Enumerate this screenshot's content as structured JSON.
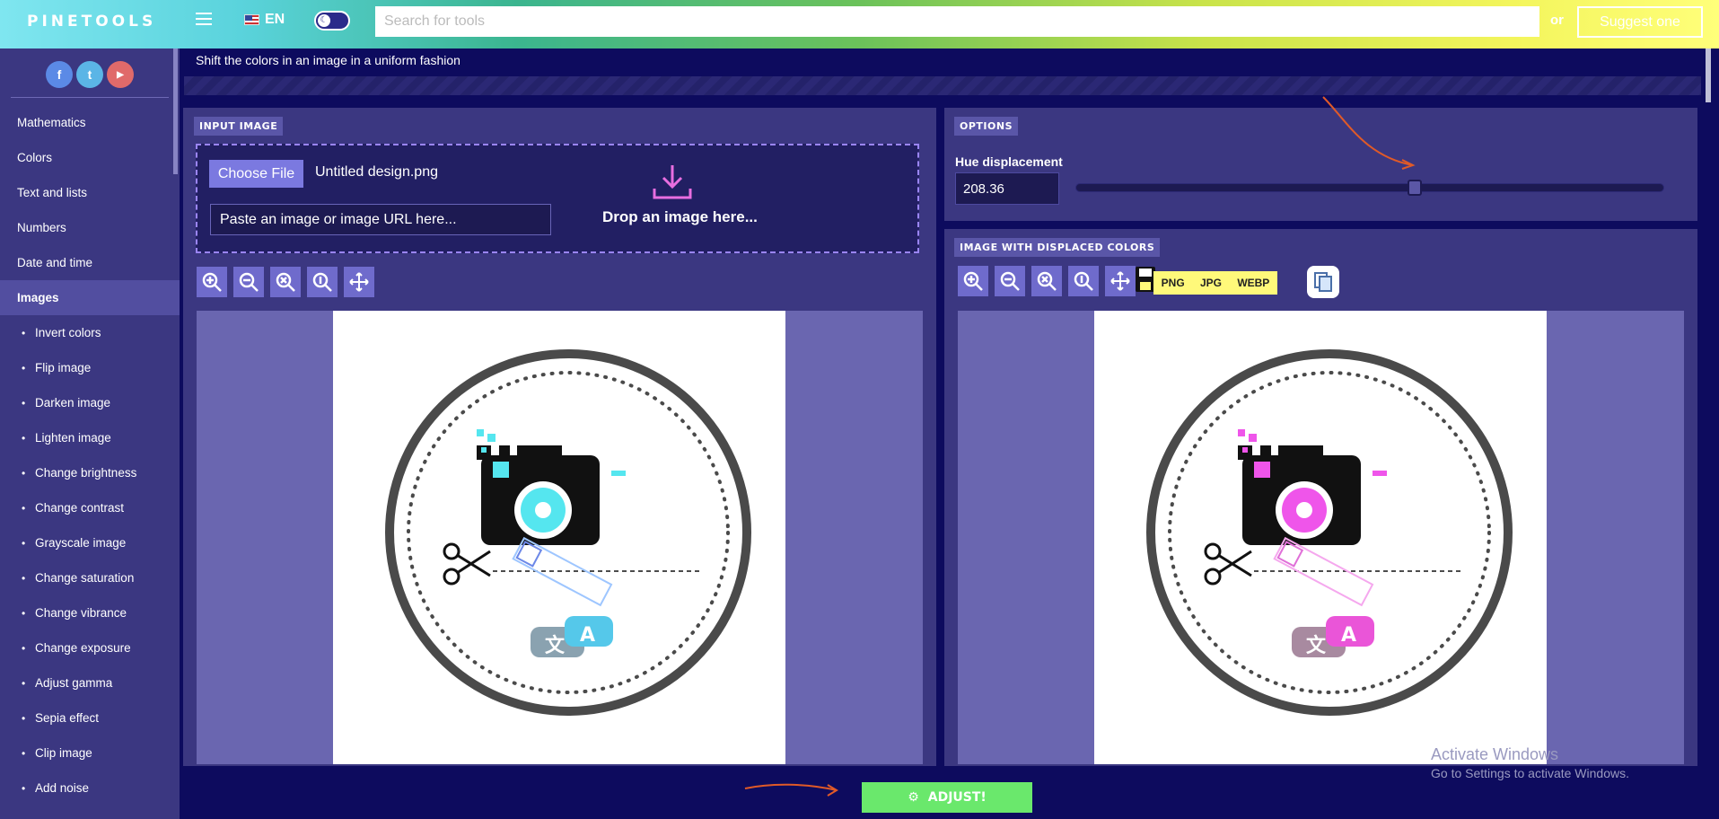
{
  "header": {
    "logo": "PINETOOLS",
    "language": "EN",
    "search_placeholder": "Search for tools",
    "or_text": "or",
    "suggest_label": "Suggest one"
  },
  "sidebar": {
    "social": [
      "f",
      "t",
      "▶"
    ],
    "items": [
      {
        "label": "Mathematics"
      },
      {
        "label": "Colors"
      },
      {
        "label": "Text and lists"
      },
      {
        "label": "Numbers"
      },
      {
        "label": "Date and time"
      },
      {
        "label": "Images"
      },
      {
        "label": "Invert colors"
      },
      {
        "label": "Flip image"
      },
      {
        "label": "Darken image"
      },
      {
        "label": "Lighten image"
      },
      {
        "label": "Change brightness"
      },
      {
        "label": "Change contrast"
      },
      {
        "label": "Grayscale image"
      },
      {
        "label": "Change saturation"
      },
      {
        "label": "Change vibrance"
      },
      {
        "label": "Change exposure"
      },
      {
        "label": "Adjust gamma"
      },
      {
        "label": "Sepia effect"
      },
      {
        "label": "Clip image"
      },
      {
        "label": "Add noise"
      }
    ]
  },
  "page": {
    "subtitle": "Shift the colors in an image in a uniform fashion"
  },
  "input_panel": {
    "tag": "INPUT IMAGE",
    "choose_label": "Choose File",
    "file_name": "Untitled design.png",
    "url_placeholder": "Paste an image or image URL here...",
    "drop_text": "Drop an image here..."
  },
  "options_panel": {
    "tag": "OPTIONS",
    "hue_label": "Hue displacement",
    "hue_value": "208.36",
    "hue_max": 360
  },
  "output_panel": {
    "tag": "IMAGE WITH DISPLACED COLORS",
    "formats": [
      "PNG",
      "JPG",
      "WEBP"
    ]
  },
  "adjust_label": "ADJUST!",
  "watermark": {
    "title": "Activate Windows",
    "sub": "Go to Settings to activate Windows."
  },
  "colors": {
    "accent": "#6ae86c",
    "original_tint": "#55e6ef",
    "displaced_tint": "#ef55ea"
  }
}
